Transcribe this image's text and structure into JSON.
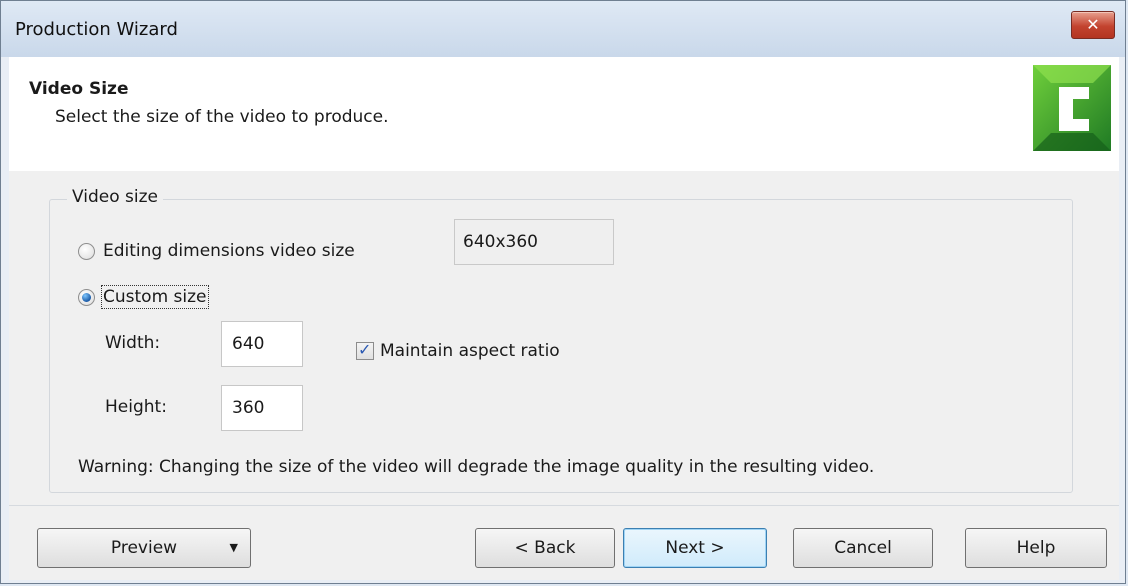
{
  "window": {
    "title": "Production Wizard",
    "close_glyph": "✕"
  },
  "header": {
    "title": "Video Size",
    "subtitle": "Select the size of the video to produce.",
    "logo_letter": "C"
  },
  "video_size": {
    "group_label": "Video size",
    "editing_option": {
      "label": "Editing dimensions video size",
      "selected": false
    },
    "editing_dimensions": "640x360",
    "custom_option": {
      "label": "Custom size",
      "selected": true
    },
    "width_label": "Width:",
    "width_value": "640",
    "height_label": "Height:",
    "height_value": "360",
    "maintain_aspect_label": "Maintain aspect ratio",
    "maintain_aspect_checked": true,
    "warning": "Warning: Changing the size of the video will degrade the image quality in the resulting video."
  },
  "footer": {
    "preview_label": "Preview",
    "back_label": "< Back",
    "next_label": "Next >",
    "cancel_label": "Cancel",
    "help_label": "Help"
  },
  "colors": {
    "accent": "#3c7fb1",
    "logo_green": "#2f9b2a",
    "close_red": "#c3432f"
  }
}
